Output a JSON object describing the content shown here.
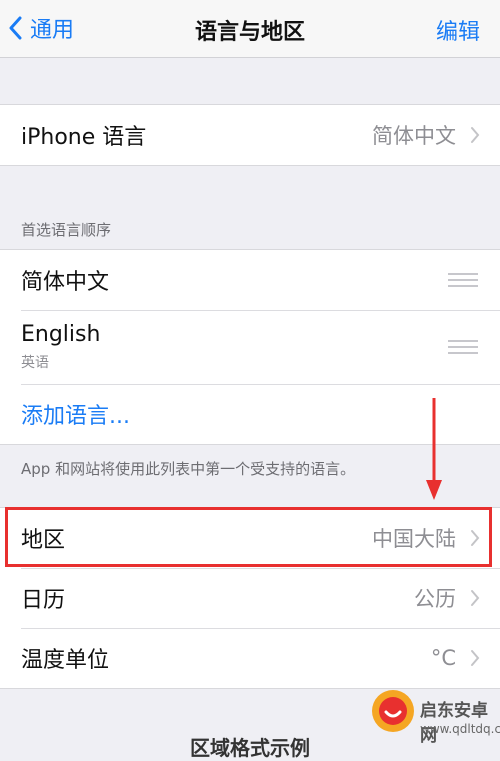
{
  "navbar": {
    "back_label": "通用",
    "title": "语言与地区",
    "edit_label": "编辑"
  },
  "iphone_language": {
    "label": "iPhone 语言",
    "value": "简体中文"
  },
  "preferred_languages": {
    "header": "首选语言顺序",
    "items": [
      {
        "label": "简体中文"
      },
      {
        "label": "English",
        "sublabel": "英语"
      }
    ],
    "add_label": "添加语言...",
    "footer": "App 和网站将使用此列表中第一个受支持的语言。"
  },
  "region_settings": [
    {
      "label": "地区",
      "value": "中国大陆"
    },
    {
      "label": "日历",
      "value": "公历"
    },
    {
      "label": "温度单位",
      "value": "°C"
    }
  ],
  "bottom_peek": "区域格式示例",
  "watermark": {
    "name": "启东安卓网",
    "url": "www.qdltdq.com"
  },
  "colors": {
    "accent": "#1a7cf5",
    "highlight": "#e8302f",
    "background": "#efeff4"
  }
}
